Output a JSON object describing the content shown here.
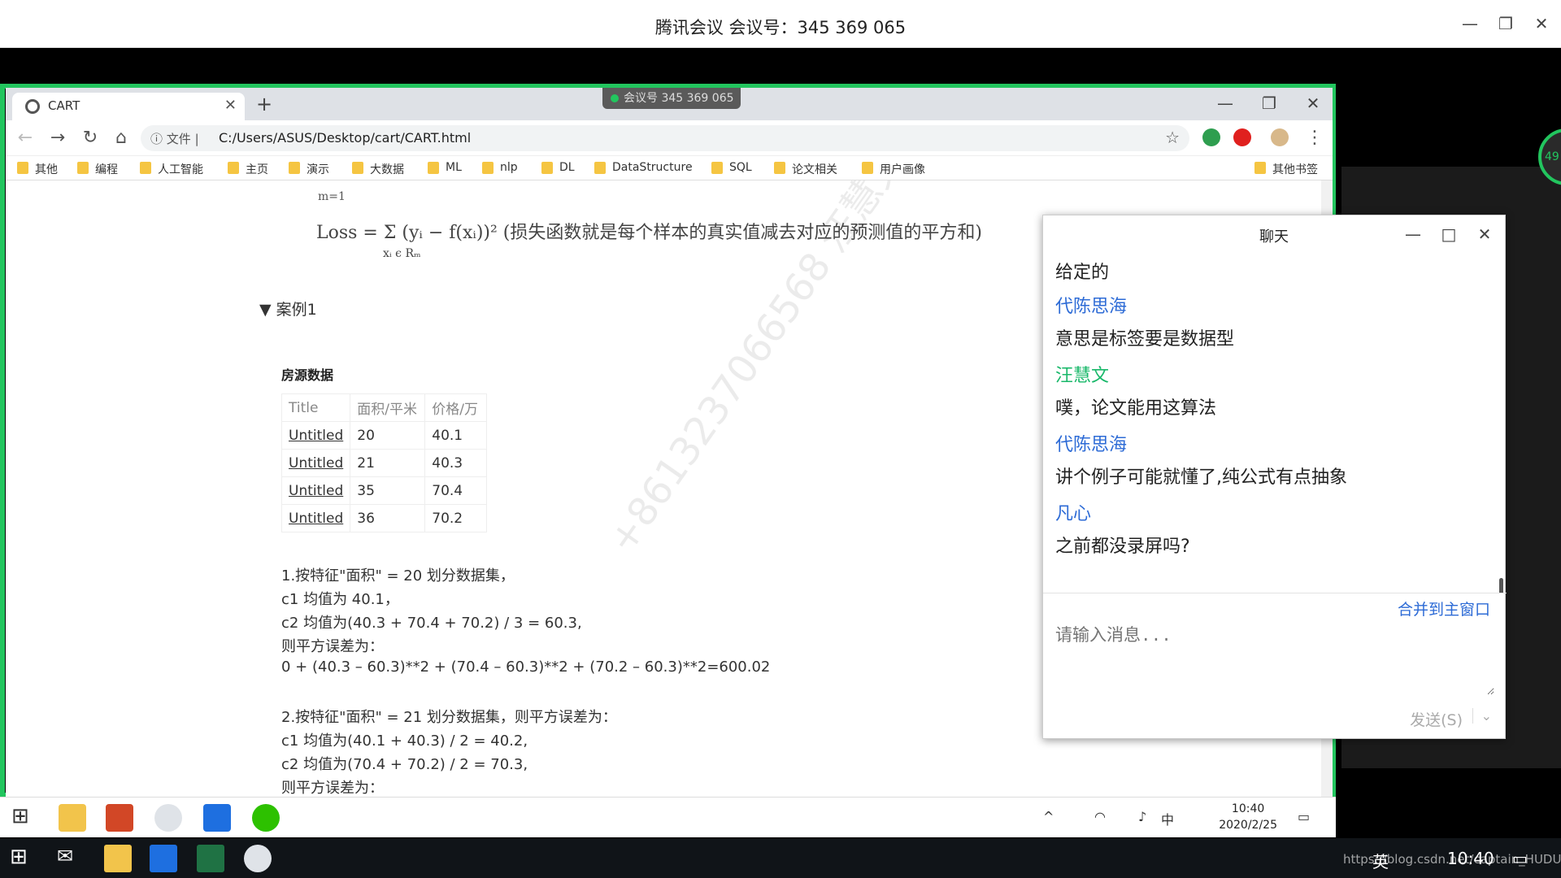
{
  "meeting": {
    "title": "腾讯会议 会议号：345 369 065",
    "pill": "会议号 345 369 065",
    "participants_badge": "49"
  },
  "browser": {
    "tab_title": "CART",
    "url_scheme": "文件",
    "url": "C:/Users/ASUS/Desktop/cart/CART.html",
    "bookmarks": [
      "其他",
      "编程",
      "人工智能",
      "主页",
      "演示",
      "大数据",
      "ML",
      "nlp",
      "DL",
      "DataStructure",
      "SQL",
      "论文相关",
      "用户画像"
    ],
    "other_bookmarks": "其他书签"
  },
  "page": {
    "formula_loss": "Loss = Σ (yᵢ − f(xᵢ))² (损失函数就是每个样本的真实值减去对应的预测值的平方和)",
    "formula_loss_sub": "xᵢ ϵ Rₘ",
    "formula_top_sub": "m=1",
    "case_title": "案例1",
    "section_title": "房源数据",
    "table": {
      "headers": [
        "Title",
        "面积/平米",
        "价格/万"
      ],
      "rows": [
        [
          "Untitled",
          "20",
          "40.1"
        ],
        [
          "Untitled",
          "21",
          "40.3"
        ],
        [
          "Untitled",
          "35",
          "70.4"
        ],
        [
          "Untitled",
          "36",
          "70.2"
        ]
      ]
    },
    "calc_lines": [
      "1.按特征\"面积\" = 20 划分数据集，",
      "c1 均值为 40.1，",
      "c2 均值为(40.3 + 70.4 + 70.2) / 3 = 60.3,",
      "则平方误差为：",
      "0 +   (40.3 – 60.3)**2 +   (70.4 – 60.3)**2 +  (70.2 – 60.3)**2=600.02",
      "",
      "2.按特征\"面积\" = 21 划分数据集，则平方误差为：",
      "c1 均值为(40.1 + 40.3) / 2 = 40.2,",
      "c2 均值为(70.4 + 70.2) / 2 = 70.3,",
      "则平方误差为："
    ],
    "watermark": "+8613237066568 汪慧文"
  },
  "chat": {
    "title": "聊天",
    "messages": [
      {
        "type": "text",
        "text": "给定的"
      },
      {
        "type": "name",
        "text": "代陈思海"
      },
      {
        "type": "text",
        "text": "意思是标签要是数据型"
      },
      {
        "type": "name-green",
        "text": "汪慧文"
      },
      {
        "type": "text",
        "text": "噗，论文能用这算法"
      },
      {
        "type": "name",
        "text": "代陈思海"
      },
      {
        "type": "text",
        "text": "讲个例子可能就懂了,纯公式有点抽象"
      },
      {
        "type": "name",
        "text": "凡心"
      },
      {
        "type": "text",
        "text": "之前都没录屏吗?"
      }
    ],
    "merge_link": "合并到主窗口",
    "input_placeholder": "请输入消息...",
    "send_label": "发送(S)"
  },
  "taskbar_inner": {
    "ime": "中",
    "time": "10:40",
    "date": "2020/2/25"
  },
  "taskbar": {
    "ime": "英",
    "time": "10:40",
    "watermark": "https://blog.csdn.net/captain_HUDU"
  },
  "colors": {
    "share_border": "#22c55e",
    "chat_name": "#2d6bd6",
    "chat_name_self": "#19b86a"
  }
}
